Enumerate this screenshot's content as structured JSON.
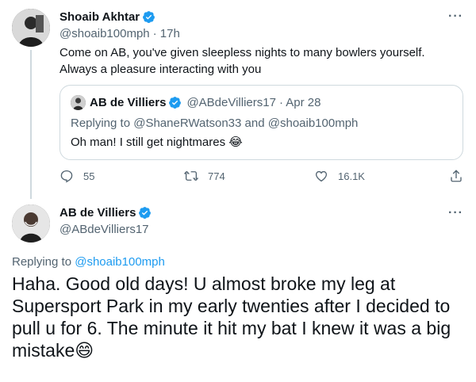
{
  "shoaib_tweet": {
    "name": "Shoaib Akhtar",
    "handle": "@shoaib100mph",
    "time": "· 17h",
    "text_line1": "Come on AB, you've given sleepless nights to many bowlers yourself.",
    "text_line2": "Always a pleasure interacting with you",
    "more": "···"
  },
  "quoted_tweet": {
    "name": "AB de Villiers",
    "handle": "@ABdeVilliers17",
    "date": "· Apr 28",
    "replying_prefix": "Replying to",
    "replying_user1": "@ShaneRWatson33",
    "replying_and": "and",
    "replying_user2": "@shoaib100mph",
    "text": "Oh man! I still get nightmares 😂"
  },
  "actions": {
    "reply_count": "55",
    "retweet_count": "774",
    "like_count": "16.1K"
  },
  "ab_reply": {
    "name": "AB de Villiers",
    "handle": "@ABdeVilliers17",
    "more": "···",
    "replying_prefix": "Replying to",
    "replying_user": "@shoaib100mph",
    "text": "Haha. Good old days! U almost broke my leg at Supersport Park in my early twenties after I decided to pull u for 6. The minute it hit my bat I knew it was a big mistake😄"
  },
  "colors": {
    "verified": "#1d9bf0",
    "link": "#1d9bf0",
    "secondary": "#536471",
    "border": "#cfd9de"
  },
  "icons": [
    "verified-badge-icon",
    "reply-icon",
    "retweet-icon",
    "like-icon",
    "share-icon",
    "more-icon"
  ]
}
